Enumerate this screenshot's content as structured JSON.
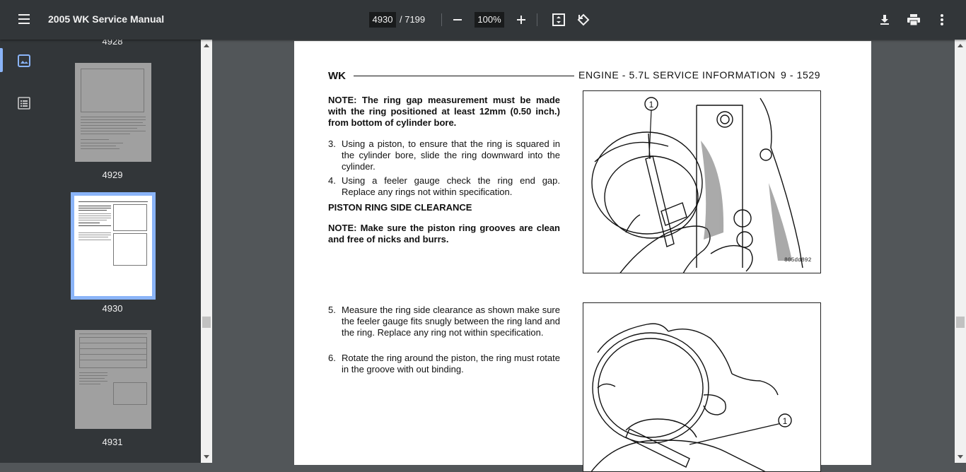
{
  "toolbar": {
    "title": "2005 WK Service Manual",
    "current_page": "4930",
    "total_pages": "/ 7199",
    "zoom": "100%"
  },
  "sidebar": {
    "thumbnails": [
      {
        "label": "4928"
      },
      {
        "label": "4929"
      },
      {
        "label": "4930"
      },
      {
        "label": "4931"
      }
    ]
  },
  "page": {
    "header_left": "WK",
    "header_right": "ENGINE - 5.7L SERVICE INFORMATION",
    "header_page": "9 - 1529",
    "note1": "NOTE: The ring gap measurement must be made with the ring positioned at least 12mm (0.50 inch.) from bottom of cylinder bore.",
    "step3_num": "3.",
    "step3": "Using a piston, to ensure that the ring is squared in the cylinder bore, slide the ring downward into the cylinder.",
    "step4_num": "4.",
    "step4": "Using a feeler gauge check the ring end gap. Replace any rings not within specification.",
    "section_heading": "PISTON RING SIDE CLEARANCE",
    "note2": "NOTE: Make sure the piston ring grooves are clean and free of nicks and burrs.",
    "step5_num": "5.",
    "step5": "Measure the ring side clearance as shown make sure the feeler gauge fits snugly between the ring land and the ring. Replace any ring not within specification.",
    "step6_num": "6.",
    "step6": "Rotate the ring around the piston, the ring must rotate in the groove with out binding.",
    "fig1_callout": "1",
    "fig1_code": "805dd892",
    "fig2_callout": "1"
  }
}
